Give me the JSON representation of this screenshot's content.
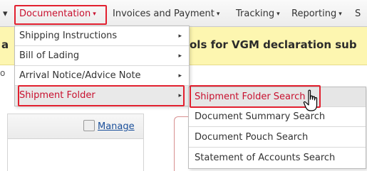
{
  "nav": {
    "partial_left": "▾",
    "items": [
      {
        "label": "Documentation",
        "caret": "▾",
        "active": true
      },
      {
        "label": "Invoices and Payment",
        "caret": "▾"
      },
      {
        "label": "Tracking",
        "caret": "▾"
      },
      {
        "label": "Reporting",
        "caret": "▾"
      },
      {
        "label": "S"
      }
    ]
  },
  "banner": {
    "left_fragment": "a",
    "text": "ols for VGM declaration sub"
  },
  "background": {
    "left_char": "o",
    "manage_label": "Manage"
  },
  "documentation_menu": {
    "items": [
      {
        "label": "Shipping Instructions",
        "arrow": "▸"
      },
      {
        "label": "Bill of Lading",
        "arrow": "▸"
      },
      {
        "label": "Arrival Notice/Advice Note",
        "arrow": "▸"
      },
      {
        "label": "Shipment Folder",
        "arrow": "▸",
        "selected": true
      }
    ]
  },
  "shipment_folder_submenu": {
    "items": [
      {
        "label": "Shipment Folder Search",
        "selected": true
      },
      {
        "label": "Document Summary Search"
      },
      {
        "label": "Document Pouch Search"
      },
      {
        "label": "Statement of Accounts Search"
      }
    ]
  },
  "colors": {
    "accent": "#c8102e",
    "highlight_box": "#e2202f",
    "banner_bg": "#fdf6b0"
  }
}
